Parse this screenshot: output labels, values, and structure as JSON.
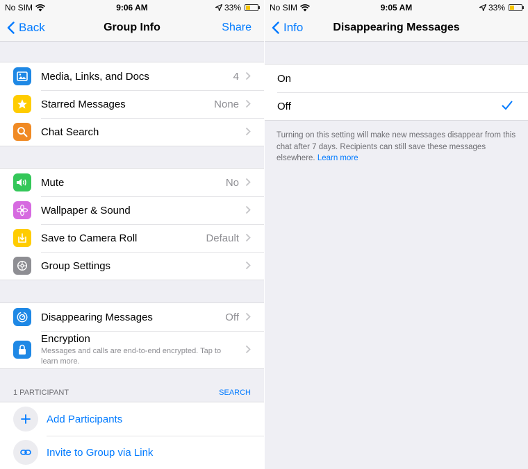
{
  "left": {
    "status": {
      "carrier": "No SIM",
      "time": "9:06 AM",
      "battery": "33%"
    },
    "nav": {
      "back": "Back",
      "title": "Group Info",
      "action": "Share"
    },
    "group1": [
      {
        "label": "Media, Links, and Docs",
        "value": "4",
        "icon": "photo-icon",
        "color": "#1e88e5"
      },
      {
        "label": "Starred Messages",
        "value": "None",
        "icon": "star-icon",
        "color": "#ffcc00"
      },
      {
        "label": "Chat Search",
        "value": "",
        "icon": "search-icon",
        "color": "#f08a24"
      }
    ],
    "group2": [
      {
        "label": "Mute",
        "value": "No",
        "icon": "speaker-icon",
        "color": "#34c759"
      },
      {
        "label": "Wallpaper & Sound",
        "value": "",
        "icon": "flower-icon",
        "color": "#d66ae0"
      },
      {
        "label": "Save to Camera Roll",
        "value": "Default",
        "icon": "download-icon",
        "color": "#ffcc00"
      },
      {
        "label": "Group Settings",
        "value": "",
        "icon": "gear-icon",
        "color": "#8e8e93"
      }
    ],
    "group3": {
      "disappearing": {
        "label": "Disappearing Messages",
        "value": "Off",
        "icon": "timer-icon",
        "color": "#1e88e5"
      },
      "encryption": {
        "label": "Encryption",
        "description": "Messages and calls are end-to-end encrypted. Tap to learn more.",
        "icon": "lock-icon",
        "color": "#1e88e5"
      }
    },
    "participants": {
      "header": "1 PARTICIPANT",
      "search": "SEARCH",
      "add": "Add Participants",
      "invite": "Invite to Group via Link"
    }
  },
  "right": {
    "status": {
      "carrier": "No SIM",
      "time": "9:05 AM",
      "battery": "33%"
    },
    "nav": {
      "back": "Info",
      "title": "Disappearing Messages"
    },
    "options": [
      {
        "label": "On",
        "selected": false
      },
      {
        "label": "Off",
        "selected": true
      }
    ],
    "footnote": {
      "text": "Turning on this setting will make new messages disappear from this chat after 7 days. Recipients can still save these messages elsewhere.",
      "link": "Learn more"
    }
  },
  "colors": {
    "accent": "#007aff",
    "background": "#efeff4",
    "secondary_text": "#8e8e93"
  }
}
